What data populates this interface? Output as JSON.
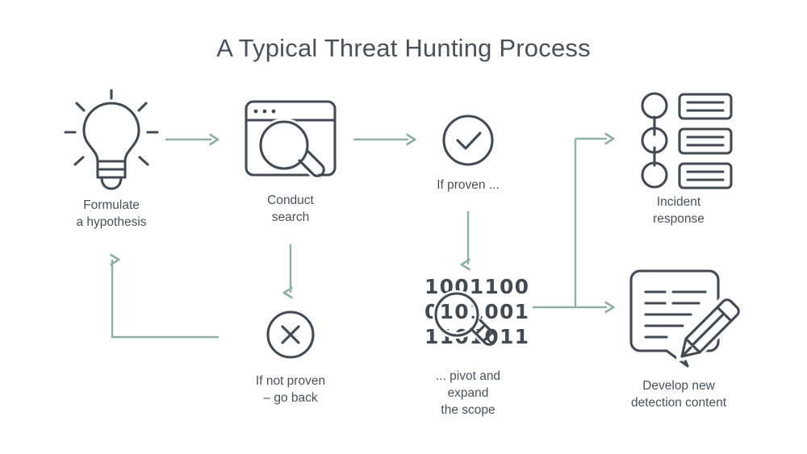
{
  "page": {
    "title": "A Typical Threat Hunting Process",
    "background": "#ffffff",
    "icon_color": "#434a52",
    "text_color": "#4a5159",
    "arrow_color": "#8fafa4"
  },
  "nodes": {
    "hypothesis": {
      "icon": "lightbulb-icon",
      "caption": "Formulate\na hypothesis"
    },
    "search": {
      "icon": "browser-magnifier-icon",
      "caption": "Conduct\nsearch"
    },
    "proven": {
      "icon": "check-circle-icon",
      "caption": "If proven ..."
    },
    "not_proven": {
      "icon": "x-circle-icon",
      "caption": "If not proven\n– go back"
    },
    "pivot": {
      "icon": "binary-magnifier-icon",
      "caption": "... pivot and\nexpand\nthe scope",
      "binary_rows": [
        "1001100",
        "0101001",
        "1101011"
      ]
    },
    "incident": {
      "icon": "checklist-timeline-icon",
      "caption": "Incident\nresponse"
    },
    "develop": {
      "icon": "speech-bubble-pencil-icon",
      "caption": "Develop new\ndetection content"
    }
  },
  "connectors": [
    {
      "name": "hypothesis-to-search",
      "kind": "arrow-right"
    },
    {
      "name": "search-to-proven",
      "kind": "arrow-right"
    },
    {
      "name": "search-to-not-proven",
      "kind": "arrow-down"
    },
    {
      "name": "proven-to-pivot",
      "kind": "arrow-down"
    },
    {
      "name": "not-proven-to-hypothesis",
      "kind": "elbow-loop-up"
    },
    {
      "name": "pivot-to-incident",
      "kind": "elbow-branch-up-right"
    },
    {
      "name": "pivot-to-develop",
      "kind": "arrow-right"
    }
  ]
}
